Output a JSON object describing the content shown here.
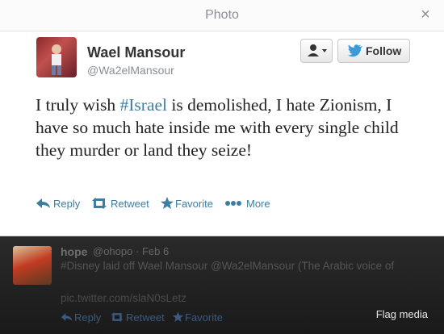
{
  "modal": {
    "title": "Photo",
    "close_label": "×"
  },
  "tweet": {
    "author_name": "Wael Mansour",
    "author_handle": "@Wa2elMansour",
    "follow_label": "Follow",
    "text_part1": "I truly wish ",
    "hashtag": "#Israel",
    "text_part2": " is demolished, I hate Zionism, I have so much hate inside me with every single child they murder or land they seize!",
    "actions": {
      "reply": "Reply",
      "retweet": "Retweet",
      "favorite": "Favorite",
      "more": "More"
    }
  },
  "reply_tweet": {
    "author_name": "hope",
    "author_handle": "@ohopo",
    "date": "· Feb 6",
    "text": "#Disney laid off Wael Mansour @Wa2elMansour (The Arabic voice of",
    "link": "pic.twitter.com/slaN0sLetz",
    "actions": {
      "reply": "Reply",
      "retweet": "Retweet",
      "favorite": "Favorite"
    }
  },
  "flag_media": "Flag media",
  "colors": {
    "accent": "#3b7ea1",
    "text": "#222222",
    "muted": "#8a8f96"
  },
  "icons": {
    "close": "close-icon",
    "user": "user-icon",
    "bird": "twitter-bird-icon",
    "reply": "reply-icon",
    "retweet": "retweet-icon",
    "favorite": "star-icon",
    "more": "more-dots-icon"
  }
}
